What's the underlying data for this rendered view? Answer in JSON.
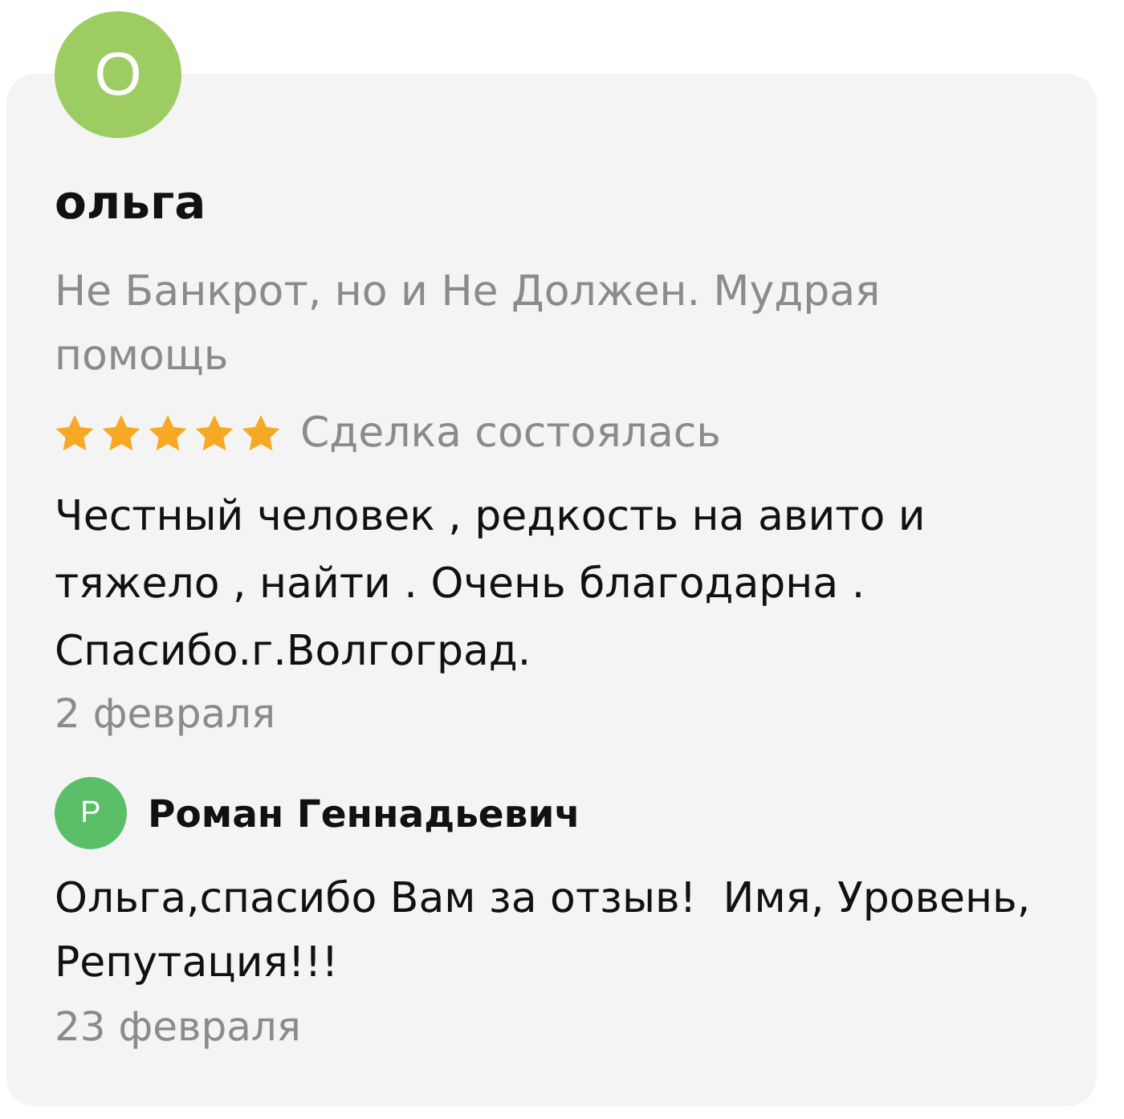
{
  "review": {
    "avatar_letter": "О",
    "author": "ольга",
    "title": "Не Банкрот, но и Не Должен. Мудрая помощь",
    "stars": 5,
    "status": "Сделка состоялась",
    "text": "Честный человек , редкость на авито и тяжело , найти . Очень благодарна . Спасибо.г.Волгоград.",
    "date": "2 февраля"
  },
  "reply": {
    "avatar_letter": "Р",
    "author": "Роман Геннадьевич",
    "text": "Ольга,спасибо Вам за отзыв!  Имя, Уровень, Репутация!!!",
    "date": "23 февраля"
  }
}
